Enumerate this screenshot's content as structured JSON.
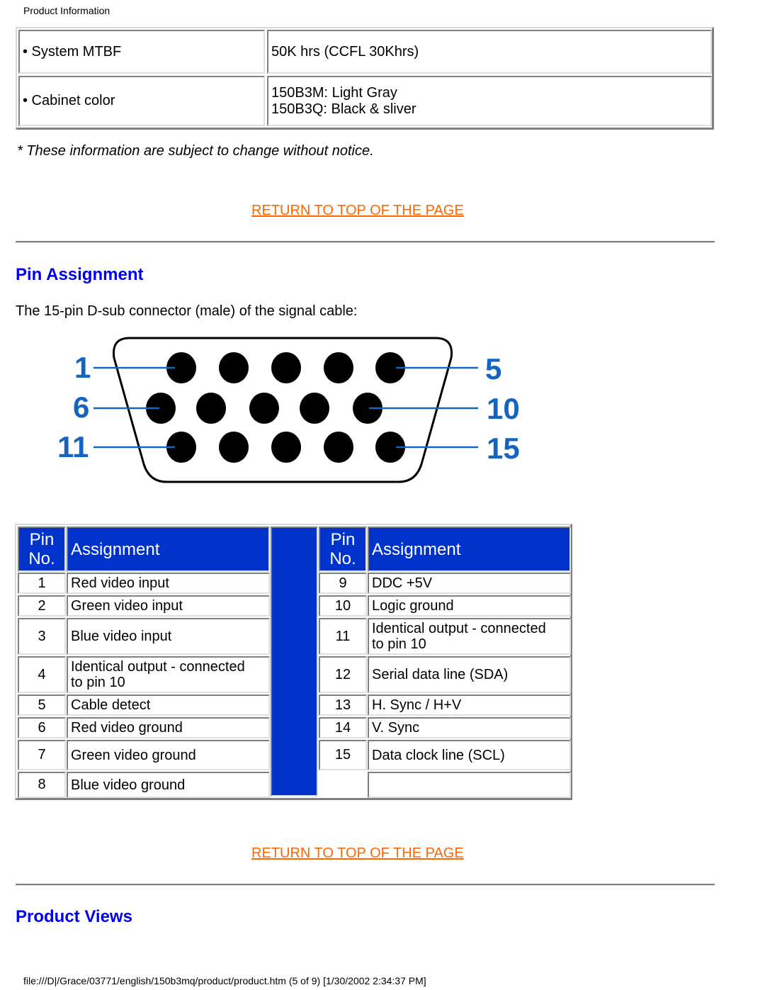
{
  "header": {
    "title": "Product Information"
  },
  "specs": [
    {
      "label": "• System MTBF",
      "value_lines": [
        "50K hrs (CCFL 30Khrs)"
      ]
    },
    {
      "label": "• Cabinet color",
      "value_lines": [
        "150B3M: Light Gray",
        "150B3Q: Black & sliver"
      ]
    }
  ],
  "note": "* These information are subject to change without notice.",
  "return_link": "RETURN TO TOP OF THE PAGE",
  "pin_section": {
    "title": "Pin Assignment",
    "description": "The 15-pin D-sub connector (male) of the signal cable:",
    "diagram": {
      "labels": {
        "top_left": "1",
        "top_right": "5",
        "mid_left": "6",
        "mid_right": "10",
        "bottom_left": "11",
        "bottom_right": "15"
      },
      "pin_rows": [
        5,
        5,
        5
      ],
      "label_color": "#1565c0"
    },
    "table": {
      "header_pin": [
        "Pin",
        "No."
      ],
      "header_assignment": "Assignment",
      "header_color": "#0033cc",
      "left": [
        {
          "pin": "1",
          "assignment": [
            "Red video input"
          ]
        },
        {
          "pin": "2",
          "assignment": [
            "Green video input"
          ]
        },
        {
          "pin": "3",
          "assignment": [
            "Blue video input"
          ]
        },
        {
          "pin": "4",
          "assignment": [
            "Identical output - connected",
            "to pin 10"
          ]
        },
        {
          "pin": "5",
          "assignment": [
            "Cable detect"
          ]
        },
        {
          "pin": "6",
          "assignment": [
            "Red video ground"
          ]
        },
        {
          "pin": "7",
          "assignment": [
            "Green video ground"
          ]
        },
        {
          "pin": "8",
          "assignment": [
            "Blue video ground"
          ]
        }
      ],
      "right": [
        {
          "pin": "9",
          "assignment": [
            "DDC +5V"
          ]
        },
        {
          "pin": "10",
          "assignment": [
            "Logic ground"
          ]
        },
        {
          "pin": "11",
          "assignment": [
            "Identical output - connected",
            "to pin 10"
          ]
        },
        {
          "pin": "12",
          "assignment": [
            "Serial data line (SDA)"
          ]
        },
        {
          "pin": "13",
          "assignment": [
            "H. Sync / H+V"
          ]
        },
        {
          "pin": "14",
          "assignment": [
            "V. Sync"
          ]
        },
        {
          "pin": "15",
          "assignment": [
            "Data clock line (SCL)"
          ]
        },
        {
          "pin": "",
          "assignment": [
            ""
          ]
        }
      ]
    }
  },
  "views_section": {
    "title": "Product Views"
  },
  "footer": "file:///D|/Grace/03771/english/150b3mq/product/product.htm (5 of 9) [1/30/2002 2:34:37 PM]"
}
